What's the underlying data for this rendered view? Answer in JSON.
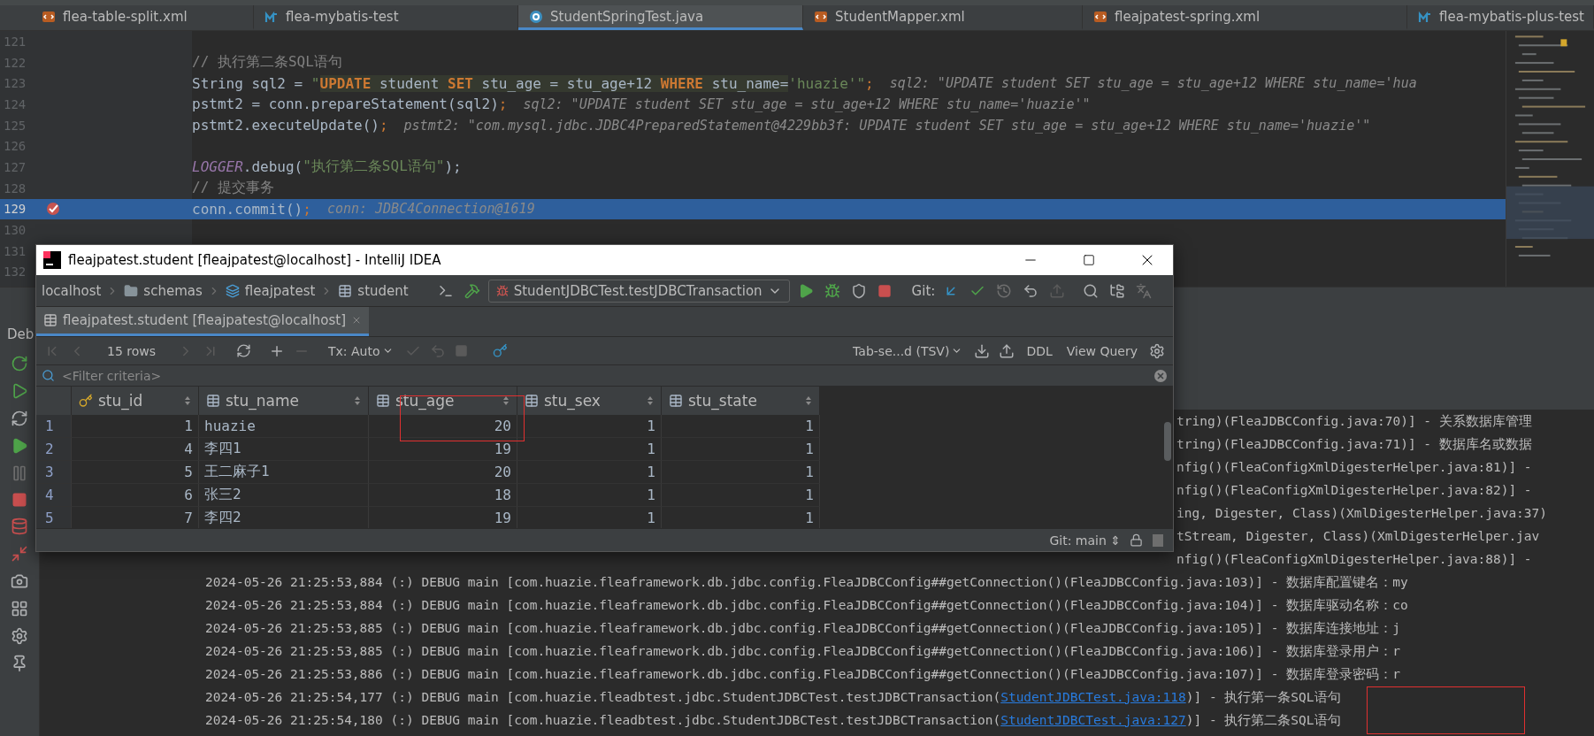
{
  "editor_tabs": [
    {
      "label": "flea-table-split.xml",
      "kind": "xml",
      "selected": false
    },
    {
      "label": "flea-mybatis-test",
      "kind": "module",
      "selected": false
    },
    {
      "label": "StudentSpringTest.java",
      "kind": "java",
      "selected": true
    },
    {
      "label": "StudentMapper.xml",
      "kind": "xml",
      "selected": false
    },
    {
      "label": "fleajpatest-spring.xml",
      "kind": "xml",
      "selected": false
    },
    {
      "label": "flea-mybatis-plus-test",
      "kind": "module",
      "selected": false
    }
  ],
  "code_lines": [
    {
      "number": "121",
      "current": false,
      "breakpoint": false
    },
    {
      "number": "122",
      "current": false,
      "breakpoint": false,
      "tokens": [
        {
          "text": "// 执行第二条SQL语句",
          "kind": "comment"
        }
      ]
    },
    {
      "number": "123",
      "current": false,
      "breakpoint": false,
      "tokens": [
        {
          "text": "String sql2 = ",
          "kind": "plain"
        },
        {
          "text": "\"",
          "kind": "string"
        },
        {
          "text": "UPDATE",
          "kind": "sqlkw"
        },
        {
          "text": " student ",
          "kind": "sql"
        },
        {
          "text": "SET",
          "kind": "sqlkw"
        },
        {
          "text": " stu_age = stu_age+12 ",
          "kind": "sql"
        },
        {
          "text": "WHERE",
          "kind": "sqlkw"
        },
        {
          "text": " stu_name=",
          "kind": "sql"
        },
        {
          "text": "'huazie'",
          "kind": "string"
        },
        {
          "text": "\"",
          "kind": "string"
        },
        {
          "text": ";",
          "kind": "keyword"
        },
        {
          "text": "sql2: \"UPDATE student SET stu_age = stu_age+12 WHERE stu_name='hua",
          "kind": "hint"
        }
      ]
    },
    {
      "number": "124",
      "current": false,
      "breakpoint": false,
      "tokens": [
        {
          "text": "pstmt2",
          "kind": "var"
        },
        {
          "text": " = ",
          "kind": "plain"
        },
        {
          "text": "conn",
          "kind": "var"
        },
        {
          "text": ".prepareStatement(sql2)",
          "kind": "plain"
        },
        {
          "text": ";",
          "kind": "keyword"
        },
        {
          "text": "sql2: \"UPDATE student SET stu_age = stu_age+12 WHERE stu_name='huazie'\"",
          "kind": "hint"
        }
      ]
    },
    {
      "number": "125",
      "current": false,
      "breakpoint": false,
      "tokens": [
        {
          "text": "pstmt2",
          "kind": "var"
        },
        {
          "text": ".executeUpdate()",
          "kind": "plain"
        },
        {
          "text": ";",
          "kind": "keyword"
        },
        {
          "text": "pstmt2: \"com.mysql.jdbc.JDBC4PreparedStatement@4229bb3f: UPDATE student SET stu_age = stu_age+12 WHERE stu_name='huazie'\"",
          "kind": "hint"
        }
      ]
    },
    {
      "number": "126",
      "current": false,
      "breakpoint": false
    },
    {
      "number": "127",
      "current": false,
      "breakpoint": false,
      "tokens": [
        {
          "text": "LOGGER",
          "kind": "static"
        },
        {
          "text": ".debug(",
          "kind": "plain"
        },
        {
          "text": "\"执行第二条SQL语句\"",
          "kind": "string"
        },
        {
          "text": ");",
          "kind": "plain"
        }
      ]
    },
    {
      "number": "128",
      "current": false,
      "breakpoint": false,
      "tokens": [
        {
          "text": "// 提交事务",
          "kind": "comment"
        }
      ]
    },
    {
      "number": "129",
      "current": true,
      "breakpoint": true,
      "tokens": [
        {
          "text": "conn",
          "kind": "var"
        },
        {
          "text": ".commit()",
          "kind": "plain"
        },
        {
          "text": ";",
          "kind": "keyword"
        },
        {
          "text": "conn: JDBC4Connection@1619",
          "kind": "hint"
        }
      ]
    },
    {
      "number": "130",
      "current": false,
      "breakpoint": false
    },
    {
      "number": "131",
      "current": false,
      "breakpoint": false
    },
    {
      "number": "132",
      "current": false,
      "breakpoint": false
    }
  ],
  "debug_panel": {
    "title": "Deb"
  },
  "log_lines": [
    {
      "kind": "fragment",
      "text": "tring)(FleaJDBCConfig.java:70)] - 关系数据库管理"
    },
    {
      "kind": "fragment",
      "text": "tring)(FleaJDBCConfig.java:71)] - 数据库名或数据"
    },
    {
      "kind": "fragment",
      "text": "nfig()(FleaConfigXmlDigesterHelper.java:81)] -"
    },
    {
      "kind": "fragment",
      "text": "nfig()(FleaConfigXmlDigesterHelper.java:82)] -"
    },
    {
      "kind": "fragment",
      "text": "ing, Digester, Class)(XmlDigesterHelper.java:37)"
    },
    {
      "kind": "fragment",
      "text": "tStream, Digester, Class)(XmlDigesterHelper.jav"
    },
    {
      "kind": "fragment",
      "text": "nfig()(FleaConfigXmlDigesterHelper.java:88)] -"
    },
    {
      "kind": "full",
      "text": "2024-05-26 21:25:53,884 (:) DEBUG main [com.huazie.fleaframework.db.jdbc.config.FleaJDBCConfig##getConnection()(FleaJDBCConfig.java:103)] - 数据库配置键名：my"
    },
    {
      "kind": "full",
      "text": "2024-05-26 21:25:53,884 (:) DEBUG main [com.huazie.fleaframework.db.jdbc.config.FleaJDBCConfig##getConnection()(FleaJDBCConfig.java:104)] - 数据库驱动名称：co"
    },
    {
      "kind": "full",
      "text": "2024-05-26 21:25:53,885 (:) DEBUG main [com.huazie.fleaframework.db.jdbc.config.FleaJDBCConfig##getConnection()(FleaJDBCConfig.java:105)] - 数据库连接地址：j"
    },
    {
      "kind": "full",
      "text": "2024-05-26 21:25:53,885 (:) DEBUG main [com.huazie.fleaframework.db.jdbc.config.FleaJDBCConfig##getConnection()(FleaJDBCConfig.java:106)] - 数据库登录用户：r"
    },
    {
      "kind": "full",
      "text": "2024-05-26 21:25:53,886 (:) DEBUG main [com.huazie.fleaframework.db.jdbc.config.FleaJDBCConfig##getConnection()(FleaJDBCConfig.java:107)] - 数据库登录密码：r"
    },
    {
      "kind": "linked",
      "text": "2024-05-26 21:25:54,177 (:) DEBUG main [com.huazie.fleadbtest.jdbc.StudentJDBCTest.testJDBCTransaction(",
      "link": "StudentJDBCTest.java:118",
      "after": ")] - 执行第一条SQL语句"
    },
    {
      "kind": "linked",
      "text": "2024-05-26 21:25:54,180 (:) DEBUG main [com.huazie.fleadbtest.jdbc.StudentJDBCTest.testJDBCTransaction(",
      "link": "StudentJDBCTest.java:127",
      "after": ")] - 执行第二条SQL语句"
    }
  ],
  "db_window": {
    "title": "fleajpatest.student [fleajpatest@localhost] - IntelliJ IDEA",
    "breadcrumbs": [
      {
        "label": "localhost",
        "kind": "server"
      },
      {
        "label": "schemas",
        "kind": "folder"
      },
      {
        "label": "fleajpatest",
        "kind": "schema"
      },
      {
        "label": "student",
        "kind": "table"
      }
    ],
    "run_config": "StudentJDBCTest.testJDBCTransaction",
    "git_label": "Git:",
    "tab": {
      "label": "fleajpatest.student [fleajpatest@localhost]",
      "selected": true
    },
    "row_count": "15 rows",
    "tx_mode": "Tx: Auto",
    "export_format": "Tab-se...d (TSV)",
    "ddl": "DDL",
    "view_query": "View Query",
    "filter": {
      "placeholder": "<Filter criteria>"
    },
    "columns": [
      {
        "label": "stu_id",
        "kind": "key"
      },
      {
        "label": "stu_name",
        "kind": "column"
      },
      {
        "label": "stu_age",
        "kind": "column"
      },
      {
        "label": "stu_sex",
        "kind": "column"
      },
      {
        "label": "stu_state",
        "kind": "column"
      }
    ],
    "rows": [
      {
        "number": "1",
        "cells": [
          "1",
          "huazie",
          "20",
          "1",
          "1"
        ]
      },
      {
        "number": "2",
        "cells": [
          "4",
          "李四1",
          "19",
          "1",
          "1"
        ]
      },
      {
        "number": "3",
        "cells": [
          "5",
          "王二麻子1",
          "20",
          "1",
          "1"
        ]
      },
      {
        "number": "4",
        "cells": [
          "6",
          "张三2",
          "18",
          "1",
          "1"
        ]
      },
      {
        "number": "5",
        "cells": [
          "7",
          "李四2",
          "19",
          "1",
          "1"
        ]
      }
    ],
    "status": "Git: main ⇕"
  }
}
